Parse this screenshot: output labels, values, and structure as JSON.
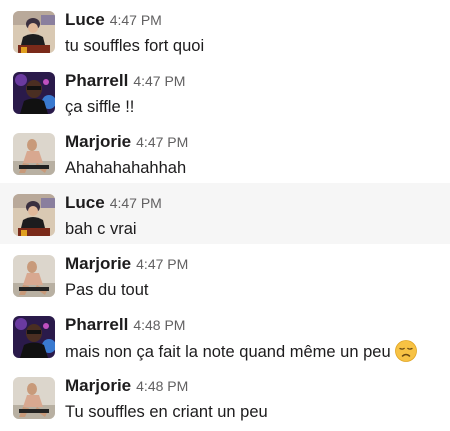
{
  "messages": [
    {
      "author": "Luce",
      "time": "4:47 PM",
      "text": "tu souffles fort quoi",
      "avatar_icon": "luce-avatar-icon"
    },
    {
      "author": "Pharrell",
      "time": "4:47 PM",
      "text": "ça siffle !!",
      "avatar_icon": "pharrell-avatar-icon"
    },
    {
      "author": "Marjorie",
      "time": "4:47 PM",
      "text": "Ahahahahahhah",
      "avatar_icon": "marjorie-avatar-icon"
    },
    {
      "author": "Luce",
      "time": "4:47 PM",
      "text": "bah c vrai",
      "avatar_icon": "luce-avatar-icon",
      "highlighted": true
    },
    {
      "author": "Marjorie",
      "time": "4:47 PM",
      "text": "Pas du tout",
      "avatar_icon": "marjorie-avatar-icon"
    },
    {
      "author": "Pharrell",
      "time": "4:48 PM",
      "text": "mais non ça fait la note quand même un peu",
      "avatar_icon": "pharrell-avatar-icon",
      "trailing_emoji": "disappointed-face-emoji"
    },
    {
      "author": "Marjorie",
      "time": "4:48 PM",
      "text": "Tu souffles en criant un peu",
      "avatar_icon": "marjorie-avatar-icon"
    }
  ],
  "colors": {
    "name": "#1d1c1d",
    "timestamp": "#616061",
    "text": "#1d1c1d",
    "hover_background": "#f6f6f6"
  }
}
